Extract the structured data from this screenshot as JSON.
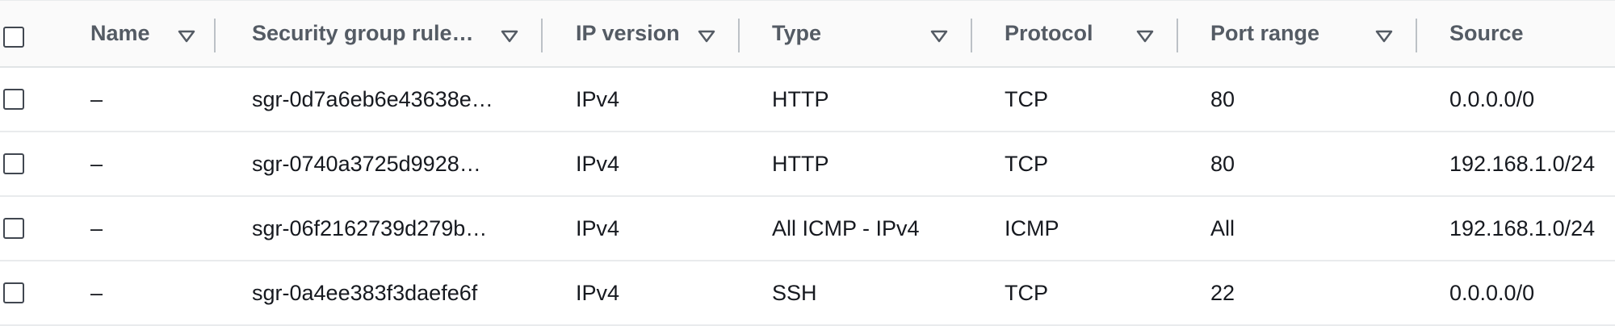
{
  "table": {
    "columns": [
      {
        "label": "Name",
        "sortable": true
      },
      {
        "label": "Security group rule…",
        "sortable": true
      },
      {
        "label": "IP version",
        "sortable": true
      },
      {
        "label": "Type",
        "sortable": true
      },
      {
        "label": "Protocol",
        "sortable": true
      },
      {
        "label": "Port range",
        "sortable": true
      },
      {
        "label": "Source",
        "sortable": false
      }
    ],
    "rows": [
      {
        "name": "–",
        "rule_id": "sgr-0d7a6eb6e43638e…",
        "ip_version": "IPv4",
        "type": "HTTP",
        "protocol": "TCP",
        "port_range": "80",
        "source": "0.0.0.0/0"
      },
      {
        "name": "–",
        "rule_id": "sgr-0740a3725d9928…",
        "ip_version": "IPv4",
        "type": "HTTP",
        "protocol": "TCP",
        "port_range": "80",
        "source": "192.168.1.0/24"
      },
      {
        "name": "–",
        "rule_id": "sgr-06f2162739d279b…",
        "ip_version": "IPv4",
        "type": "All ICMP - IPv4",
        "protocol": "ICMP",
        "port_range": "All",
        "source": "192.168.1.0/24"
      },
      {
        "name": "–",
        "rule_id": "sgr-0a4ee383f3daefe6f",
        "ip_version": "IPv4",
        "type": "SSH",
        "protocol": "TCP",
        "port_range": "22",
        "source": "0.0.0.0/0"
      }
    ]
  },
  "icons": {
    "sort": "sort-caret-down-icon",
    "checkbox": "checkbox-icon"
  },
  "colors": {
    "header_text": "#545b64",
    "body_text": "#16191f",
    "border": "#e9ebed",
    "checkbox_border": "#414750"
  }
}
